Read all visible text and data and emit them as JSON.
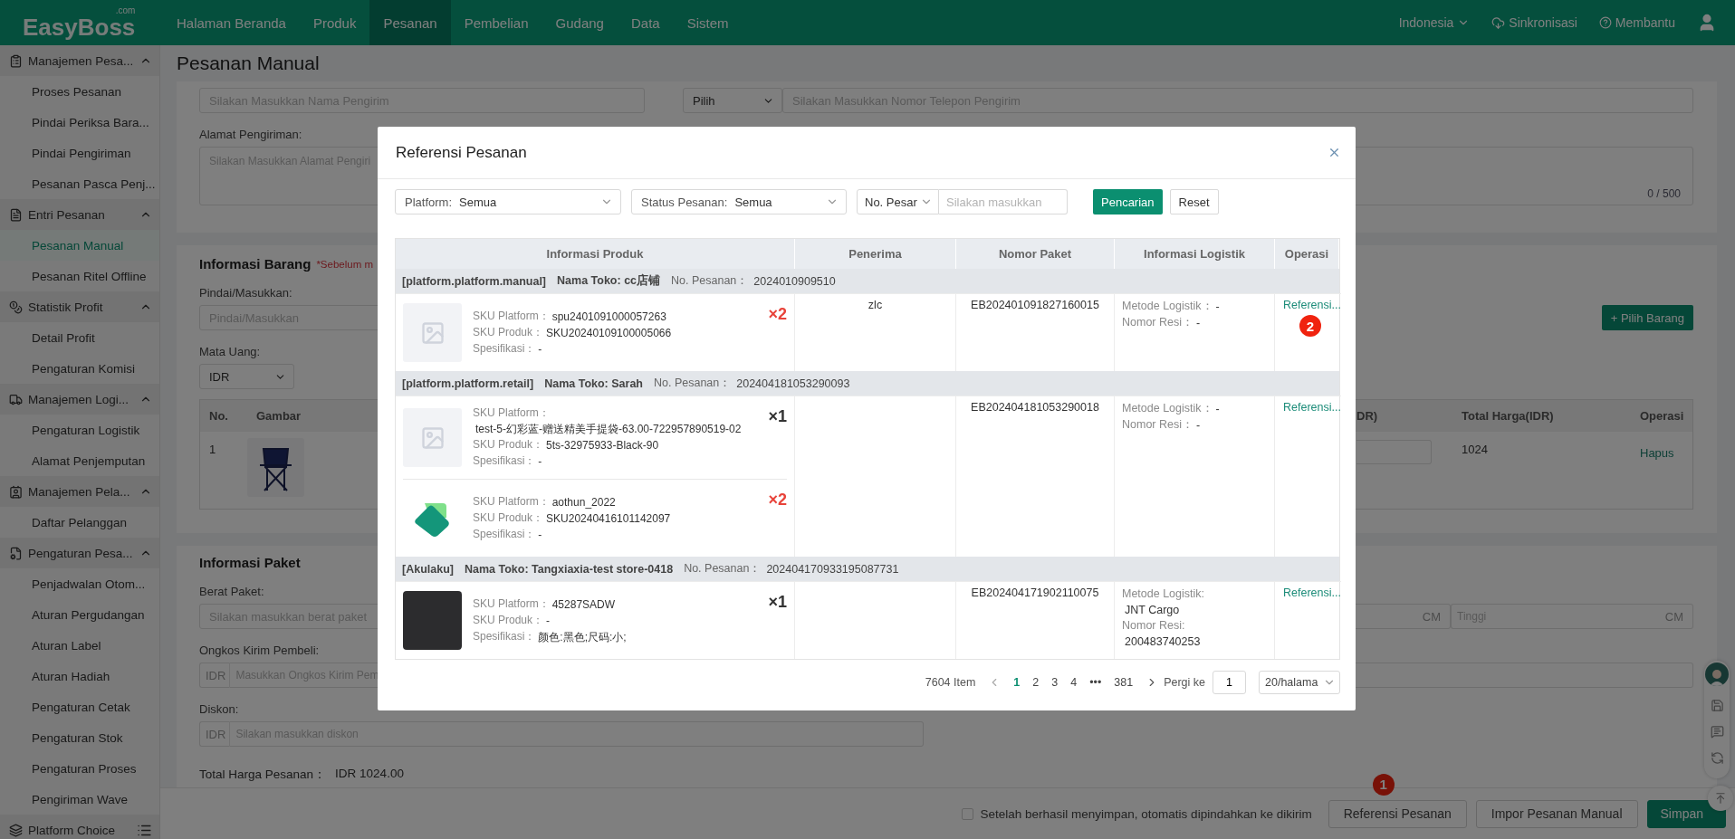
{
  "nav": {
    "logo": "EasyBoss",
    "logo_suffix": ".com",
    "items": [
      {
        "label": "Halaman Beranda",
        "selected": false
      },
      {
        "label": "Produk",
        "selected": false
      },
      {
        "label": "Pesanan",
        "selected": true
      },
      {
        "label": "Pembelian",
        "selected": false
      },
      {
        "label": "Gudang",
        "selected": false
      },
      {
        "label": "Data",
        "selected": false
      },
      {
        "label": "Sistem",
        "selected": false
      }
    ],
    "language": "Indonesia",
    "sync": "Sinkronisasi",
    "help": "Membantu"
  },
  "sidebar": {
    "groups": [
      {
        "label": "Manajemen Pesa...",
        "expanded": true,
        "children": [
          {
            "label": "Proses Pesanan",
            "selected": false
          },
          {
            "label": "Pindai Periksa Bara...",
            "selected": false
          },
          {
            "label": "Pindai Pengiriman",
            "selected": false
          },
          {
            "label": "Pesanan Pasca Penj...",
            "selected": false
          }
        ]
      },
      {
        "label": "Entri Pesanan",
        "expanded": true,
        "children": [
          {
            "label": "Pesanan Manual",
            "selected": true
          },
          {
            "label": "Pesanan Ritel Offline",
            "selected": false
          }
        ]
      },
      {
        "label": "Statistik Profit",
        "expanded": true,
        "children": [
          {
            "label": "Detail Profit",
            "selected": false
          },
          {
            "label": "Pengaturan Komisi",
            "selected": false
          }
        ]
      },
      {
        "label": "Manajemen Logi...",
        "expanded": true,
        "children": [
          {
            "label": "Pengaturan Logistik",
            "selected": false
          },
          {
            "label": "Alamat Penjemputan",
            "selected": false
          }
        ]
      },
      {
        "label": "Manajemen Pela...",
        "expanded": true,
        "children": [
          {
            "label": "Daftar Pelanggan",
            "selected": false
          }
        ]
      },
      {
        "label": "Pengaturan Pesa...",
        "expanded": true,
        "children": [
          {
            "label": "Penjadwalan Otom...",
            "selected": false
          },
          {
            "label": "Aturan Pergudangan",
            "selected": false
          },
          {
            "label": "Aturan Label",
            "selected": false
          },
          {
            "label": "Aturan Hadiah",
            "selected": false
          },
          {
            "label": "Pengaturan Cetak",
            "selected": false
          },
          {
            "label": "Pengaturan Stok",
            "selected": false
          },
          {
            "label": "Pengaturan Proses",
            "selected": false
          },
          {
            "label": "Pengiriman Wave",
            "selected": false
          }
        ]
      },
      {
        "label": "Platform Choice"
      }
    ]
  },
  "page_title": "Pesanan Manual",
  "sender": {
    "name_placeholder": "Silakan Masukkan Nama Pengirim",
    "phone_code": "Pilih",
    "phone_placeholder": "Silakan Masukkan Nomor Telepon Pengirim",
    "address_label": "Alamat Pengiriman:",
    "address_placeholder": "Silakan Masukkan Alamat Pengiri",
    "address_counter": "0 / 500"
  },
  "items_card": {
    "title": "Informasi Barang",
    "note": "*Sebelum m",
    "add_button": "+ Pilih Barang",
    "scan_label": "Pindai/Masukkan:",
    "scan_placeholder": "Pindai/Masukkan",
    "currency_label": "Mata Uang:",
    "currency": "IDR",
    "columns": [
      "No.",
      "Gambar",
      "DR)",
      "Total Harga(IDR)",
      "Operasi"
    ],
    "rows": [
      {
        "no": "1",
        "total": "1024",
        "action": "Hapus"
      }
    ]
  },
  "package_card": {
    "title": "Informasi Paket",
    "weight_label": "Berat Paket:",
    "weight_placeholder": "Silakan masukkan berat paket",
    "width_unit": "CM",
    "height_placeholder": "Tinggi",
    "height_unit": "CM",
    "shipping_label": "Ongkos Kirim Pembeli:",
    "shipping_prefix": "IDR",
    "shipping_placeholder": "Masukkan Ongkos Kirim Pem",
    "discount_label": "Diskon:",
    "discount_prefix": "IDR",
    "discount_placeholder": "Silakan masukkan diskon"
  },
  "total": {
    "label": "Total Harga Pesanan：",
    "value": "IDR 1024.00"
  },
  "footer": {
    "auto_move_checked": false,
    "auto_move_label": "Setelah berhasil menyimpan, otomatis dipindahkan ke dikirim",
    "buttons": [
      {
        "label": "Referensi Pesanan",
        "kind": "default",
        "badge": "1"
      },
      {
        "label": "Impor Pesanan Manual",
        "kind": "default"
      },
      {
        "label": "Simpan",
        "kind": "primary"
      }
    ]
  },
  "modal": {
    "title": "Referensi Pesanan",
    "filters": [
      {
        "label": "Platform:",
        "value": "Semua"
      },
      {
        "label": "Status Pesanan:",
        "value": "Semua"
      }
    ],
    "order_no_type": "No. Pesar",
    "search_placeholder": "Silakan masukkan",
    "search_button": "Pencarian",
    "reset_button": "Reset",
    "columns": [
      "Informasi Produk",
      "Penerima",
      "Nomor Paket",
      "Informasi Logistik",
      "Operasi"
    ],
    "orders": [
      {
        "platform": "[platform.platform.manual]",
        "store": "Nama Toko: cc店铺",
        "order_label": "No. Pesanan：",
        "order_no": "2024010909510",
        "recipient": "zlc",
        "package_no": "EB202401091827160015",
        "logistics": [
          {
            "kind": "inline",
            "label": "Metode Logistik：",
            "value": "-"
          },
          {
            "kind": "inline",
            "label": "Nomor Resi：",
            "value": "-"
          }
        ],
        "action": "Referensi...",
        "badge": "2",
        "products": [
          {
            "kind": "placeholder",
            "quantity": "×2",
            "alert": true,
            "details": [
              {
                "kind": "inline",
                "caption": "SKU Platform：",
                "text": "spu2401091000057263"
              },
              {
                "kind": "inline",
                "caption": "SKU Produk：",
                "text": "SKU20240109100005066"
              },
              {
                "kind": "inline",
                "caption": "Spesifikasi：",
                "text": "-"
              }
            ]
          }
        ]
      },
      {
        "platform": "[platform.platform.retail]",
        "store": "Nama Toko: Sarah",
        "order_label": "No. Pesanan：",
        "order_no": "202404181053290093",
        "package_no": "EB202404181053290018",
        "logistics": [
          {
            "kind": "inline",
            "label": "Metode Logistik：",
            "value": "-"
          },
          {
            "kind": "inline",
            "label": "Nomor Resi：",
            "value": "-"
          }
        ],
        "action": "Referensi...",
        "products": [
          {
            "kind": "placeholder",
            "quantity": "×1",
            "alert": false,
            "details": [
              {
                "kind": "stacked",
                "caption": "SKU Platform：",
                "text": "test-5-幻彩蓝-赠送精美手提袋-63.00-722957890519-02"
              },
              {
                "kind": "inline",
                "caption": "SKU Produk：",
                "text": "5ts-32975933-Black-90"
              },
              {
                "kind": "inline",
                "caption": "Spesifikasi：",
                "text": "-"
              }
            ]
          },
          {
            "kind": "logo",
            "quantity": "×2",
            "alert": true,
            "details": [
              {
                "kind": "inline",
                "caption": "SKU Platform：",
                "text": "aothun_2022"
              },
              {
                "kind": "inline",
                "caption": "SKU Produk：",
                "text": "SKU20240416101142097"
              },
              {
                "kind": "inline",
                "caption": "Spesifikasi：",
                "text": "-"
              }
            ]
          }
        ]
      },
      {
        "platform": "[Akulaku]",
        "store": "Nama Toko: Tangxiaxia-test store-0418",
        "order_label": "No. Pesanan：",
        "order_no": "202404170933195087731",
        "package_no": "EB202404171902110075",
        "logistics": [
          {
            "kind": "stacked",
            "label": "Metode Logistik:",
            "value": "JNT Cargo"
          },
          {
            "kind": "stacked",
            "label": "Nomor Resi:",
            "value": "200483740253"
          }
        ],
        "action": "Referensi...",
        "products": [
          {
            "kind": "photo",
            "quantity": "×1",
            "alert": false,
            "details": [
              {
                "kind": "inline",
                "caption": "SKU Platform：",
                "text": "45287SADW"
              },
              {
                "kind": "inline",
                "caption": "SKU Produk：",
                "text": "-"
              },
              {
                "kind": "inline",
                "caption": "Spesifikasi：",
                "text": "颜色:黑色;尺码:小;"
              }
            ]
          }
        ]
      }
    ],
    "pagination": {
      "total": "7604 Item",
      "pages": [
        {
          "label": "1",
          "selected": true
        },
        {
          "label": "2",
          "selected": false
        },
        {
          "label": "3",
          "selected": false
        },
        {
          "label": "4",
          "selected": false
        },
        {
          "label": "•••",
          "selected": false
        },
        {
          "label": "381",
          "selected": false
        }
      ],
      "goto_label": "Pergi ke",
      "goto_value": "1",
      "page_size": "20/halama"
    }
  }
}
